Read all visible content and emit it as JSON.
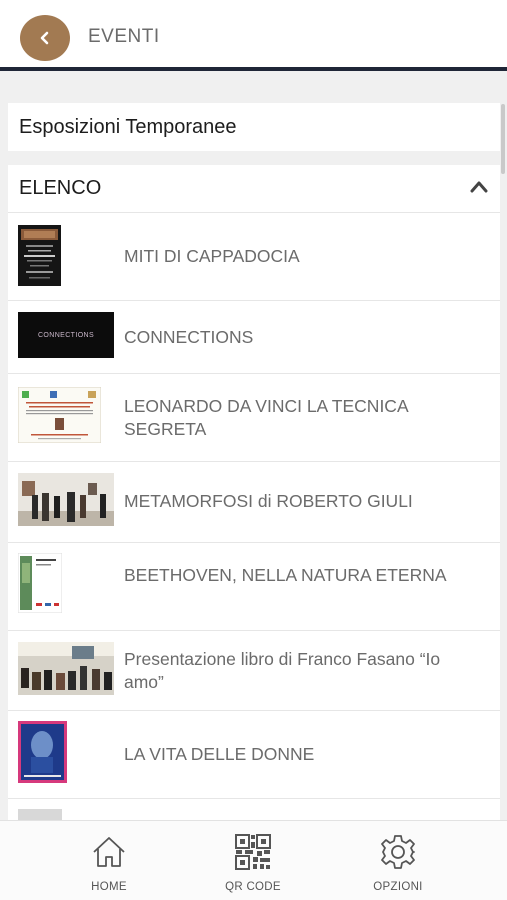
{
  "header": {
    "title": "EVENTI",
    "back_icon": "chevron-left-icon",
    "accent": "#a27a52"
  },
  "section": {
    "title": "Esposizioni Temporanee"
  },
  "list": {
    "header": "ELENCO",
    "items": [
      {
        "label": "MITI DI CAPPADOCIA"
      },
      {
        "label": "CONNECTIONS"
      },
      {
        "label": "LEONARDO DA VINCI LA TECNICA SEGRETA"
      },
      {
        "label": "METAMORFOSI di ROBERTO GIULI"
      },
      {
        "label": "BEETHOVEN, NELLA NATURA ETERNA"
      },
      {
        "label": "Presentazione libro di Franco Fasano “Io amo”"
      },
      {
        "label": "LA VITA DELLE DONNE"
      }
    ]
  },
  "thumb_texts": {
    "connections": "CONNECTIONS"
  },
  "tabbar": {
    "home": {
      "label": "HOME",
      "icon": "home-icon"
    },
    "qr": {
      "label": "QR CODE",
      "icon": "qr-code-icon"
    },
    "options": {
      "label": "OPZIONI",
      "icon": "gear-icon"
    }
  }
}
